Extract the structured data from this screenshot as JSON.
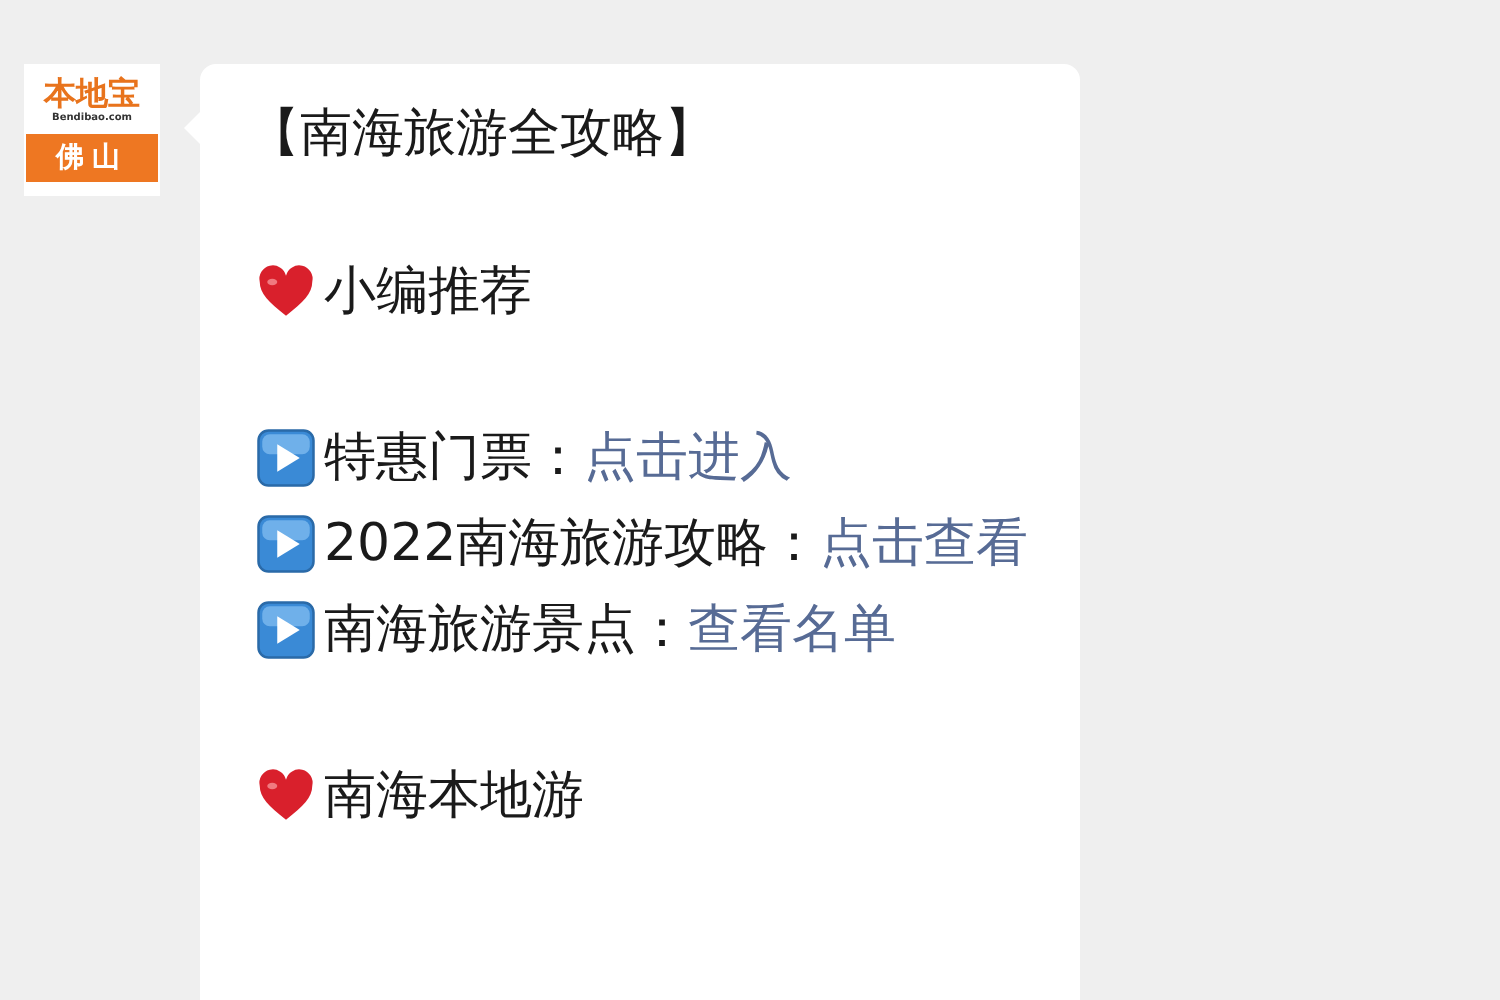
{
  "avatar": {
    "logo": "本地宝",
    "domain": "Bendibao.com",
    "city": "佛山"
  },
  "message": {
    "title": "【南海旅游全攻略】",
    "sections": [
      {
        "heading": "小编推荐",
        "items": [
          {
            "label": "特惠门票：",
            "link": "点击进入"
          },
          {
            "label": "2022南海旅游攻略：",
            "link": "点击查看"
          },
          {
            "label": "南海旅游景点：",
            "link": "查看名单"
          }
        ]
      },
      {
        "heading": "南海本地游"
      }
    ]
  }
}
